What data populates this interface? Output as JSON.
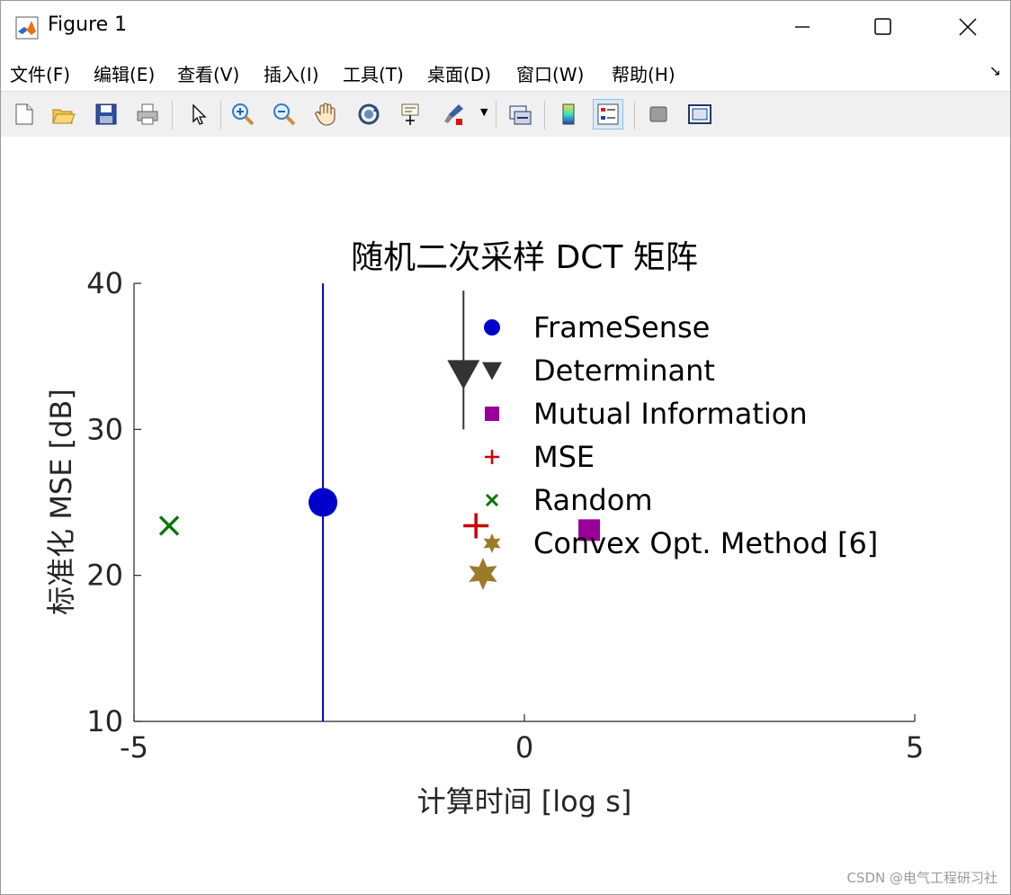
{
  "window": {
    "title": "Figure 1",
    "controls": [
      "minimize",
      "maximize",
      "close"
    ]
  },
  "menu": [
    {
      "label": "文件(F)",
      "accel": "F"
    },
    {
      "label": "编辑(E)",
      "accel": "E"
    },
    {
      "label": "查看(V)",
      "accel": "V"
    },
    {
      "label": "插入(I)",
      "accel": "I"
    },
    {
      "label": "工具(T)",
      "accel": "T"
    },
    {
      "label": "桌面(D)",
      "accel": "D"
    },
    {
      "label": "窗口(W)",
      "accel": "W"
    },
    {
      "label": "帮助(H)",
      "accel": "H"
    }
  ],
  "toolbar": [
    "new-figure-icon",
    "open-file-icon",
    "save-icon",
    "print-icon",
    "select-arrow-icon",
    "zoom-in-icon",
    "zoom-out-icon",
    "pan-hand-icon",
    "rotate-3d-icon",
    "data-cursor-icon",
    "brush-icon",
    "link-plot-icon",
    "colorbar-icon",
    "legend-icon",
    "hide-plot-tools-icon",
    "show-plot-tools-icon"
  ],
  "watermark": "CSDN @电气工程研习社",
  "chart_data": {
    "type": "scatter",
    "title": "随机二次采样 DCT 矩阵",
    "xlabel": "计算时间 [log s]",
    "ylabel": "标准化 MSE [dB]",
    "xlim": [
      -5,
      5
    ],
    "ylim": [
      10,
      40
    ],
    "xticks": [
      "-5",
      "0",
      "5"
    ],
    "yticks": [
      "10",
      "20",
      "30",
      "40"
    ],
    "grid": false,
    "legend_position": "top-right",
    "series": [
      {
        "name": "FrameSense",
        "marker": "circle",
        "color": "#0000cc",
        "x": [
          -2.58
        ],
        "y": [
          25.0
        ],
        "vline": true
      },
      {
        "name": "Determinant",
        "marker": "triangle-down",
        "color": "#333333",
        "x": [
          -0.78
        ],
        "y": [
          33.8
        ],
        "vline": true,
        "vline_range": [
          30.0,
          39.5
        ]
      },
      {
        "name": "Mutual Information",
        "marker": "square",
        "color": "#990099",
        "x": [
          0.83
        ],
        "y": [
          23.1
        ]
      },
      {
        "name": "MSE",
        "marker": "plus",
        "color": "#cc0000",
        "x": [
          -0.62
        ],
        "y": [
          23.4
        ]
      },
      {
        "name": "Random",
        "marker": "x",
        "color": "#007700",
        "x": [
          -4.55
        ],
        "y": [
          23.4
        ]
      },
      {
        "name": "Convex Opt. Method [6]",
        "marker": "hexagram",
        "color": "#9b7b2a",
        "x": [
          -0.53
        ],
        "y": [
          20.1
        ]
      }
    ]
  }
}
